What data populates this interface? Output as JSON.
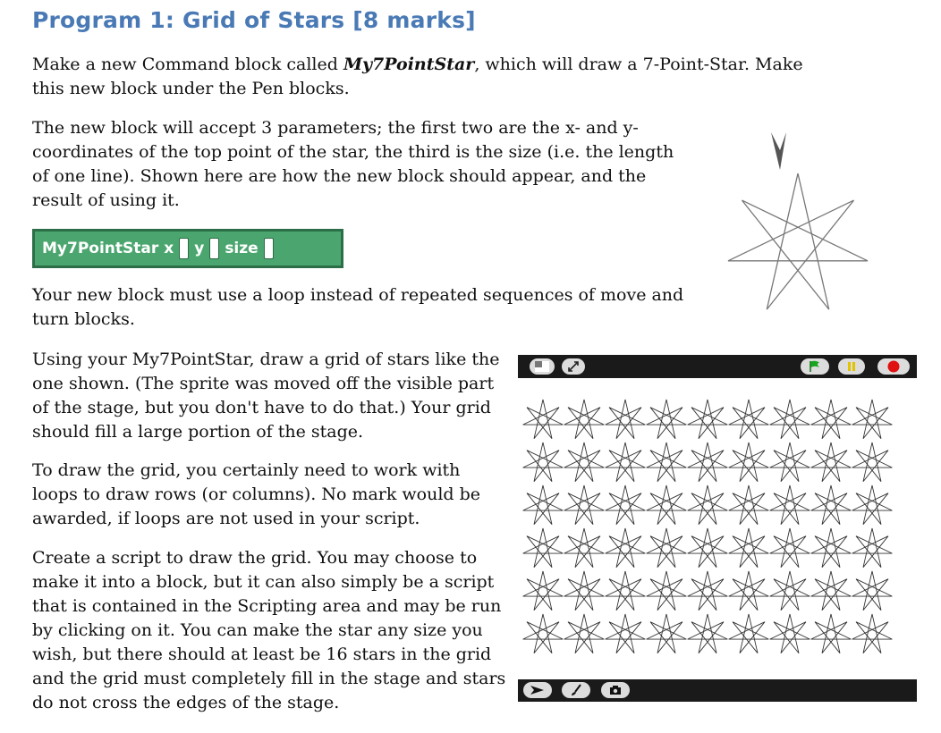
{
  "heading": "Program 1: Grid of Stars [8 marks]",
  "p1_before": "Make a new Command block called ",
  "p1_em": "My7PointStar",
  "p1_after": ", which will draw a 7-Point-Star. Make this new block under the Pen blocks.",
  "p2": "The new block will accept 3 parameters; the first two are the x- and y-coordinates of the top point of the star, the third is the size (i.e. the length of one line). Shown here are how the new block should appear, and the result of using it.",
  "block": {
    "name": "My7PointStar",
    "label_x": "x",
    "label_y": "y",
    "label_size": "size"
  },
  "p3": "Your new block must use a loop instead of repeated sequences of move and turn blocks.",
  "p4": "Using your My7PointStar, draw a grid of stars like the one shown. (The sprite was moved off the visible part of the stage, but you don't have to do that.) Your grid should fill a large portion of the stage.",
  "p5": "To draw the grid, you certainly need to work with loops to draw rows (or columns). No mark would be awarded, if loops are not used in your script.",
  "p6": "Create a script to draw the grid. You may choose to make it into a block, but it can also simply be a script that is contained in the Scripting area and may be run by clicking on it. You can make the star any size you wish, but there should at least be 16 stars in the grid and the grid must completely fill in the stage and stars do not cross the edges of the stage.",
  "stage": {
    "rows": 6,
    "cols": 9,
    "top_icons": [
      "stage-size-icon",
      "fullscreen-icon",
      "green-flag-icon",
      "pause-icon",
      "stop-icon"
    ],
    "bottom_icons": [
      "arrow-tool-icon",
      "paint-brush-icon",
      "camera-icon"
    ],
    "colors": {
      "flag": "#19a51f",
      "pause": "#e2c300",
      "stop": "#e01111",
      "bar": "#1a1a1a"
    }
  }
}
